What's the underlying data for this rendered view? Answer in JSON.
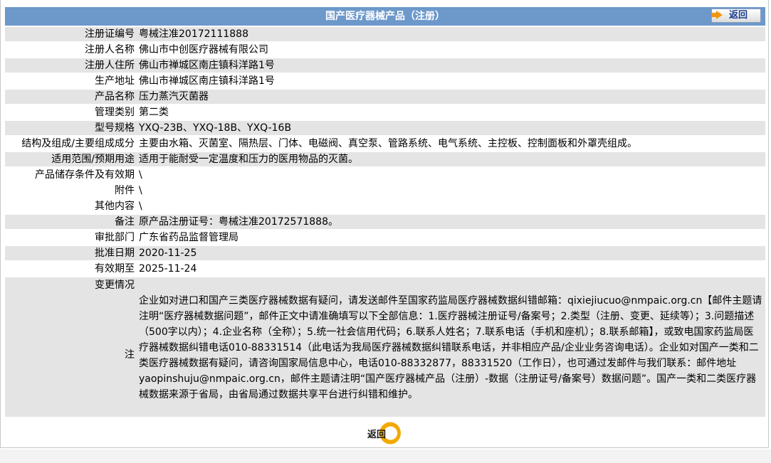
{
  "header": {
    "title": "国产医疗器械产品（注册）",
    "back_label": "返回"
  },
  "rows": [
    {
      "key": "注册证编号",
      "value": "粤械注准20172111888"
    },
    {
      "key": "注册人名称",
      "value": "佛山市中创医疗器械有限公司"
    },
    {
      "key": "注册人住所",
      "value": "佛山市禅城区南庄镇科洋路1号"
    },
    {
      "key": "生产地址",
      "value": "佛山市禅城区南庄镇科洋路1号"
    },
    {
      "key": "产品名称",
      "value": "压力蒸汽灭菌器"
    },
    {
      "key": "管理类别",
      "value": "第二类"
    },
    {
      "key": "型号规格",
      "value": "YXQ-23B、YXQ-18B、YXQ-16B"
    },
    {
      "key": "结构及组成/主要组成成分",
      "value": "主要由水箱、灭菌室、隔热层、门体、电磁阀、真空泵、管路系统、电气系统、主控板、控制面板和外罩壳组成。"
    },
    {
      "key": "适用范围/预期用途",
      "value": "适用于能耐受一定温度和压力的医用物品的灭菌。"
    },
    {
      "key": "产品储存条件及有效期",
      "value": "\\"
    },
    {
      "key": "附件",
      "value": "\\"
    },
    {
      "key": "其他内容",
      "value": "\\"
    },
    {
      "key": "备注",
      "value": "原产品注册证号：粤械注准20172571888。"
    },
    {
      "key": "审批部门",
      "value": "广东省药品监督管理局"
    },
    {
      "key": "批准日期",
      "value": "2020-11-25"
    },
    {
      "key": "有效期至",
      "value": "2025-11-24"
    }
  ],
  "changes": {
    "key": "变更情况",
    "note_key": "注",
    "note_text": "企业如对进口和国产三类医疗器械数据有疑问，请发送邮件至国家药监局医疗器械数据纠错邮箱：qixiejiucuo@nmpaic.org.cn【邮件主题请注明“医疗器械数据问题”，邮件正文中请准确填写以下全部信息：1.医疗器械注册证号/备案号；2.类型（注册、变更、延续等）；3.问题描述（500字以内）；4.企业名称（全称）；5.统一社会信用代码；6.联系人姓名；7.联系电话（手机和座机）；8.联系邮箱】，或致电国家药监局医疗器械数据纠错电话010-88331514（此电话为我局医疗器械数据纠错联系电话，并非相应产品/企业业务咨询电话）。企业如对国产一类和二类医疗器械数据有疑问，请咨询国家局信息中心，电话010-88332877，88331520（工作日），也可通过发邮件与我们联系：邮件地址yaopinshuju@nmpaic.org.cn，邮件主题请注明“国产医疗器械产品（注册）-数据（注册证号/备案号）数据问题”。国产一类和二类医疗器械数据来源于省局，由省局通过数据共享平台进行纠错和维护。"
  },
  "footer": {
    "back_label": "返回"
  },
  "colors": {
    "header_bg": "#6c98ca",
    "row_gray": "#e4e4e4",
    "accent_orange": "#f2a800"
  }
}
